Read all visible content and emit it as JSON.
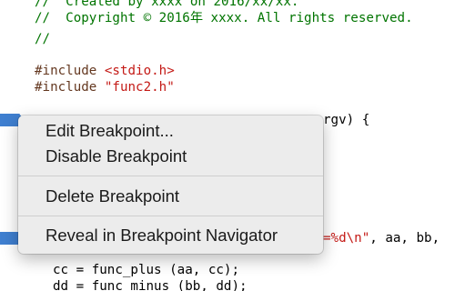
{
  "code": {
    "comment_created": "//  Created by xxxx on 2016/xx/xx.",
    "comment_copyright": "//  Copyright © 2016年 xxxx. All rights reserved.",
    "comment_empty": "//",
    "include1_directive": "#include ",
    "include1_path": "<stdio.h>",
    "include2_directive": "#include ",
    "include2_path": "\"func2.h\"",
    "main_tail": "rgv) {",
    "printf_str": "=%d\\n\"",
    "printf_tail": ", aa, bb,",
    "line_cc": "cc = func_plus (aa, cc);",
    "line_dd": "dd = func_minus (bb, dd);"
  },
  "context_menu": {
    "edit_breakpoint": "Edit Breakpoint...",
    "disable_breakpoint": "Disable Breakpoint",
    "delete_breakpoint": "Delete Breakpoint",
    "reveal_breakpoint": "Reveal in Breakpoint Navigator"
  },
  "colors": {
    "comment": "#007400",
    "preprocessor": "#643820",
    "string": "#c41a16",
    "breakpoint": "#3f7fd0",
    "menu_background": "#ececec"
  }
}
